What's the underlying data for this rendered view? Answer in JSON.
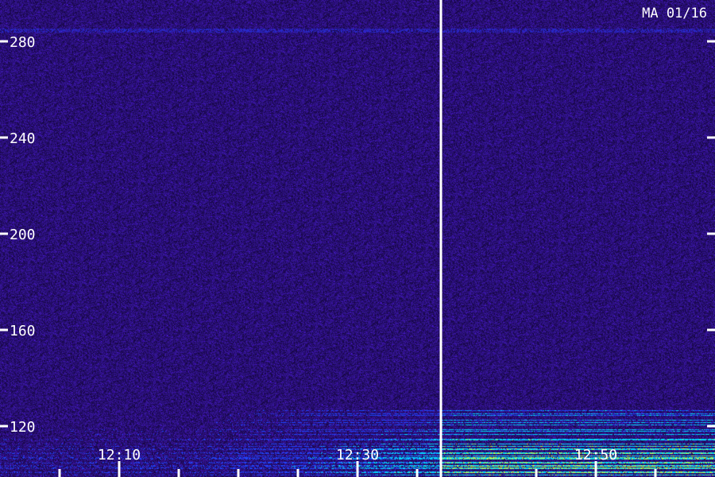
{
  "chart_data": {
    "type": "heatmap",
    "title": "",
    "xlabel": "",
    "ylabel": "",
    "station_date_label": "MA 01/16",
    "time_range": [
      "12:00",
      "13:00"
    ],
    "frequency_range": [
      100,
      290
    ],
    "x_tick_labels": [
      "12:10",
      "12:30",
      "12:50"
    ],
    "x_minor_ticks": [
      "12:05",
      "12:10",
      "12:15",
      "12:20",
      "12:25",
      "12:30",
      "12:35",
      "12:45",
      "12:50",
      "12:55"
    ],
    "y_tick_labels": [
      "280",
      "240",
      "200",
      "160",
      "120"
    ],
    "y_ticks": [
      280,
      240,
      200,
      160,
      120
    ],
    "marker_line_time": "12:37",
    "colors": {
      "background_noise": "#2a0c6a",
      "low_band": "#1e3cff",
      "bright_band": "#00e0ff",
      "peak_band": "#c8ff40",
      "axis": "#ffffff"
    }
  }
}
